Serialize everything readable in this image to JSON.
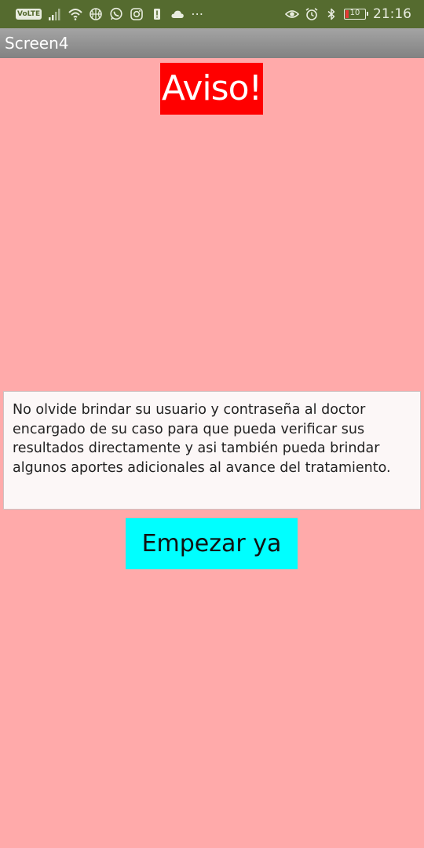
{
  "status_bar": {
    "volte_label": "VoLTE",
    "battery_level": "10",
    "time": "21:16",
    "icons": [
      "volte-icon",
      "signal-icon",
      "wifi-icon",
      "basketball-icon",
      "whatsapp-icon",
      "instagram-icon",
      "alert-icon",
      "cloud-icon",
      "more-icon",
      "eye-icon",
      "alarm-icon",
      "bluetooth-icon",
      "battery-icon"
    ],
    "colors": {
      "background": "#556b2f",
      "battery_low": "#e53935"
    }
  },
  "title_bar": {
    "title": "Screen4"
  },
  "main": {
    "notice_label": "Aviso!",
    "message": "No olvide brindar su usuario y contraseña al doctor encargado de su caso para que pueda verificar sus resultados directamente y asi también pueda brindar algunos aportes adicionales al avance del tratamiento.",
    "start_button_label": "Empezar ya",
    "colors": {
      "background": "#ffaaaa",
      "notice_bg": "#ff0000",
      "button_bg": "#00ffff"
    }
  }
}
